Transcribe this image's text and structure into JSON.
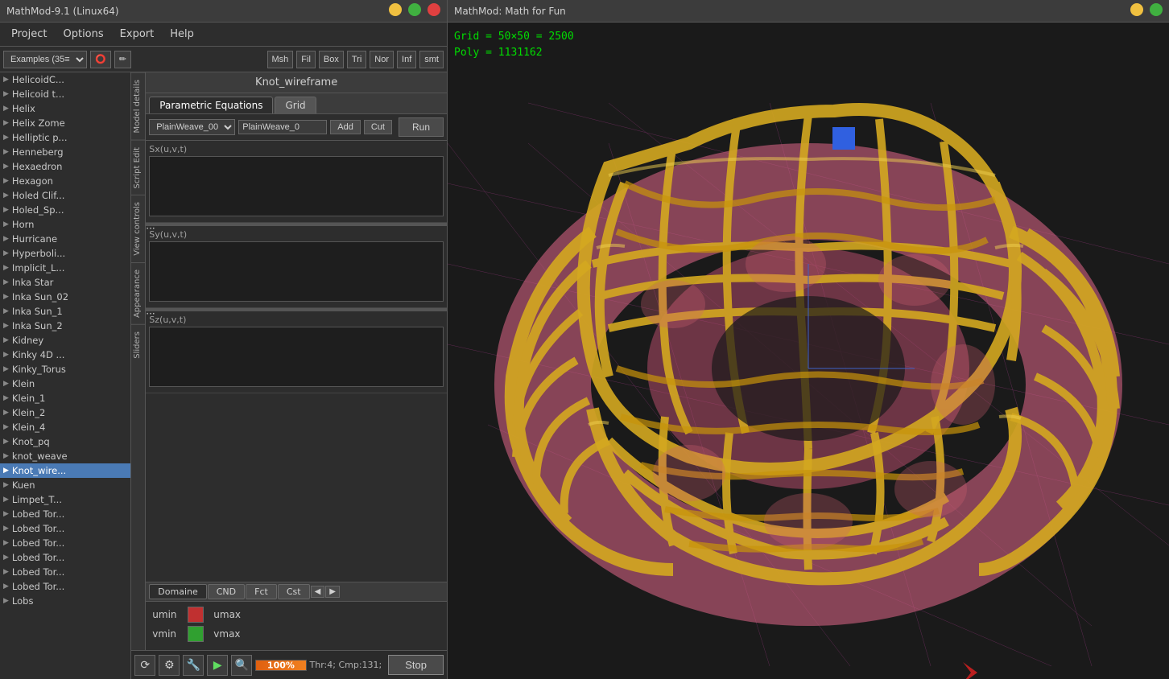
{
  "left_panel": {
    "title": "MathMod-9.1 (Linux64)",
    "menu": [
      "Project",
      "Options",
      "Export",
      "Help"
    ],
    "toolbar": {
      "examples_label": "Examples (35≡",
      "buttons": [
        "Msh",
        "Fil",
        "Box",
        "Tri",
        "Nor",
        "Inf",
        "smt"
      ]
    },
    "list_items": [
      "HelicoidC...",
      "Helicoid t...",
      "Helix",
      "Helix Zome",
      "Helliptic p...",
      "Henneberg",
      "Hexaedron",
      "Hexagon",
      "Holed Clif...",
      "Holed_Sp...",
      "Horn",
      "Hurricane",
      "Hyperboli...",
      "Implicit_L...",
      "Inka Star",
      "Inka Sun_02",
      "Inka Sun_1",
      "Inka Sun_2",
      "Kidney",
      "Kinky 4D ...",
      "Kinky_Torus",
      "Klein",
      "Klein_1",
      "Klein_2",
      "Klein_4",
      "Knot_pq",
      "knot_weave",
      "Knot_wire...",
      "Kuen",
      "Limpet_T...",
      "Lobed Tor...",
      "Lobed Tor...",
      "Lobed Tor...",
      "Lobed Tor...",
      "Lobed Tor...",
      "Lobed Tor...",
      "Lobs"
    ],
    "selected_index": 27,
    "editor": {
      "title": "Knot_wireframe",
      "tabs": [
        "Parametric Equations",
        "Grid"
      ],
      "active_tab": "Parametric Equations",
      "formula_dropdown": "PlainWeave_00",
      "formula_name": "PlainWeave_0",
      "run_button": "Run",
      "add_button": "Add",
      "cut_button": "Cut",
      "equations": [
        {
          "label": "Sx(u,v,t)",
          "value": ""
        },
        {
          "label": "Sy(u,v,t)",
          "value": ""
        },
        {
          "label": "Sz(u,v,t)",
          "value": ""
        }
      ],
      "bottom_tabs": [
        "Domaine",
        "CND",
        "Fct",
        "Cst"
      ],
      "active_bottom_tab": "Domaine",
      "domain": {
        "umin_label": "umin",
        "umax_label": "umax",
        "vmin_label": "vmin",
        "vmax_label": "vmax"
      }
    },
    "vertical_tabs": [
      "Model details",
      "Script Edit",
      "View controls",
      "Appearance",
      "Sliders"
    ],
    "status_bar": {
      "progress_percent": "100%",
      "status_text": "Thr:4; Cmp:131;",
      "stop_button": "Stop"
    }
  },
  "right_panel": {
    "title": "MathMod: Math for Fun",
    "grid_info": {
      "grid_label": "Grid = 50×50 = 2500",
      "poly_label": "Poly = 1131162"
    }
  }
}
